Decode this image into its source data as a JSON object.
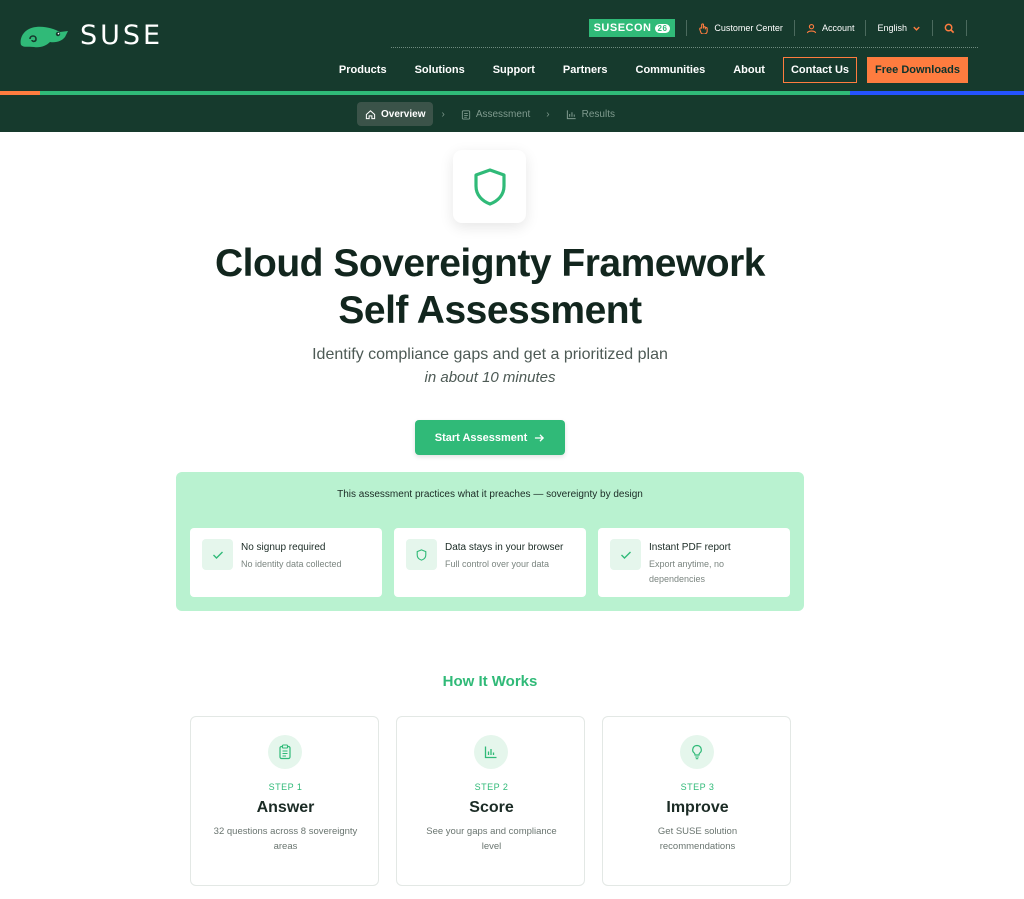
{
  "header": {
    "logo_text": "SUSE",
    "susecon": {
      "label": "SUSECON",
      "badge": "26"
    },
    "utility": [
      {
        "label": "Customer Center",
        "icon": "hand-pointer-icon"
      },
      {
        "label": "Account",
        "icon": "user-icon"
      },
      {
        "label": "English",
        "icon": "chevron-down-icon"
      }
    ],
    "search_icon": "search-icon",
    "nav": [
      "Products",
      "Solutions",
      "Support",
      "Partners",
      "Communities",
      "About"
    ],
    "contact_label": "Contact Us",
    "free_downloads_label": "Free Downloads",
    "stripe_colors": [
      "#fe7c3f",
      "#30ba78",
      "#2453ff"
    ]
  },
  "breadcrumbs": [
    {
      "label": "Overview",
      "icon": "home-icon",
      "active": true
    },
    {
      "label": "Assessment",
      "icon": "clipboard-icon",
      "active": false
    },
    {
      "label": "Results",
      "icon": "bar-chart-icon",
      "active": false
    }
  ],
  "hero": {
    "title_line1": "Cloud Sovereignty Framework",
    "title_line2": "Self Assessment",
    "subtitle": "Identify compliance gaps and get a prioritized plan",
    "subtitle_emphasis": "in about 10 minutes",
    "cta_label": "Start Assessment"
  },
  "trust_panel": {
    "heading": "This assessment practices what it preaches — sovereignty by design",
    "features": [
      {
        "title": "No signup required",
        "subtitle": "No identity data collected",
        "icon": "check-icon"
      },
      {
        "title": "Data stays in your browser",
        "subtitle": "Full control over your data",
        "icon": "shield-icon"
      },
      {
        "title": "Instant PDF report",
        "subtitle": "Export anytime, no dependencies",
        "icon": "check-icon"
      }
    ]
  },
  "how_it_works": {
    "heading": "How It Works",
    "steps": [
      {
        "step": "STEP 1",
        "title": "Answer",
        "desc": "32 questions across 8 sovereignty areas",
        "icon": "clipboard-icon"
      },
      {
        "step": "STEP 2",
        "title": "Score",
        "desc": "See your gaps and compliance level",
        "icon": "bar-chart-icon"
      },
      {
        "step": "STEP 3",
        "title": "Improve",
        "desc": "Get SUSE solution recommendations",
        "icon": "lightbulb-icon"
      }
    ]
  },
  "colors": {
    "brand_dark": "#163a2d",
    "brand_green": "#30ba78",
    "accent_orange": "#fe7c3f",
    "panel_mint": "#b9f2d0"
  }
}
